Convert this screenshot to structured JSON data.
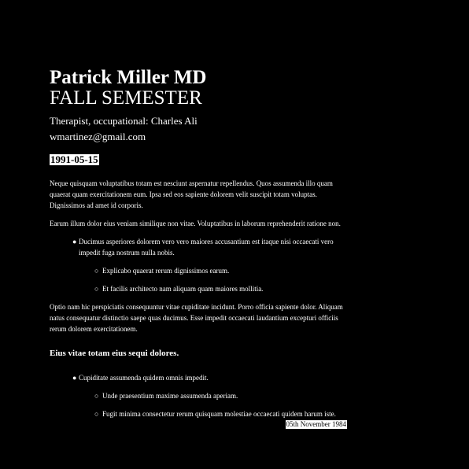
{
  "header": {
    "name": "Patrick Miller MD",
    "semester": "FALL SEMESTER",
    "role": "Therapist, occupational: Charles Ali",
    "email": "wmartinez@gmail.com",
    "date": "1991-05-15"
  },
  "body": {
    "para1": "Neque quisquam voluptatibus totam est nesciunt aspernatur repellendus. Quos assumenda illo quam quaerat quam exercitationem eum. Ipsa sed eos sapiente dolorem velit suscipit totam voluptas. Dignissimos ad amet id corporis.",
    "para2": "Earum illum dolor eius veniam similique non vitae. Voluptatibus in laborum reprehenderit ratione non.",
    "list1": {
      "item1": "Ducimus asperiores dolorem vero vero maiores accusantium est itaque nisi occaecati vero impedit fuga nostrum nulla nobis.",
      "sub1": "Explicabo quaerat rerum dignissimos earum.",
      "sub2": "Et facilis architecto nam aliquam quam maiores mollitia."
    },
    "para3": "Optio nam hic perspiciatis consequuntur vitae cupiditate incidunt. Porro officia sapiente dolor. Aliquam natus consequatur distinctio saepe quas ducimus. Esse impedit occaecati laudantium excepturi officiis rerum dolorem exercitationem.",
    "subheading": "Eius vitae totam eius sequi dolores.",
    "list2": {
      "item1": "Cupiditate assumenda quidem omnis impedit.",
      "sub1": "Unde praesentium maxime assumenda aperiam.",
      "sub2": "Fugit minima consectetur rerum quisquam molestiae occaecati quidem harum iste."
    },
    "footer_date": "05th November 1984"
  },
  "markers": {
    "bullet": "●",
    "circle": "○"
  }
}
